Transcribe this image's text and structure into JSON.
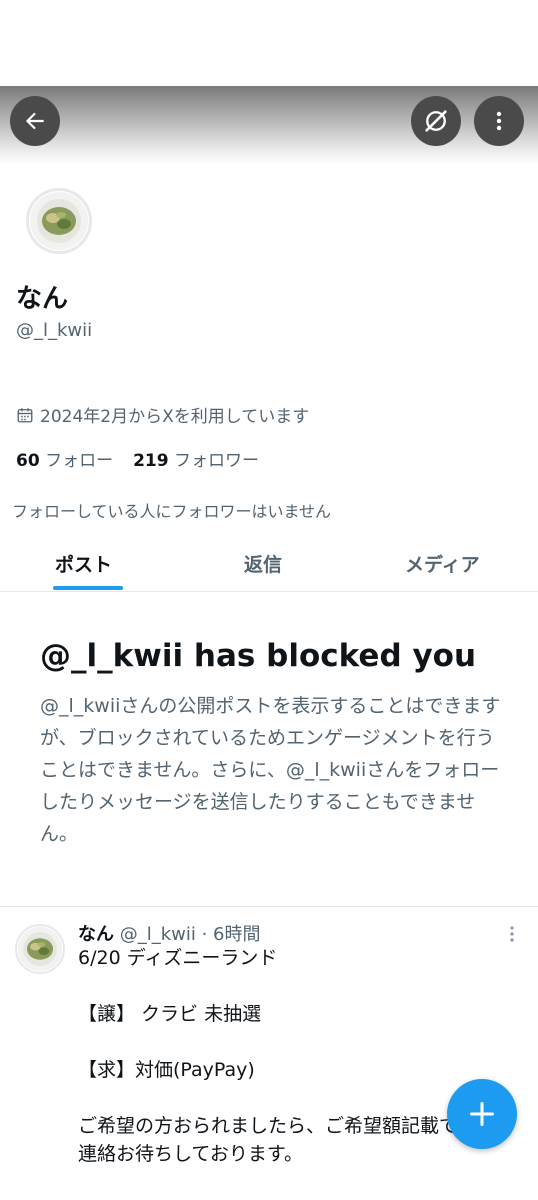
{
  "profile": {
    "display_name": "なん",
    "handle": "@_l_kwii",
    "joined": "2024年2月からXを利用しています",
    "following_count": "60",
    "following_label": "フォロー",
    "followers_count": "219",
    "followers_label": "フォロワー",
    "no_mutual_followers": "フォローしている人にフォロワーはいません"
  },
  "tabs": [
    {
      "label": "ポスト",
      "active": true
    },
    {
      "label": "返信",
      "active": false
    },
    {
      "label": "メディア",
      "active": false
    }
  ],
  "blocked": {
    "title": "@_l_kwii has blocked you",
    "description": "@_l_kwiiさんの公開ポストを表示することはできますが、ブロックされているためエンゲージメントを行うことはできません。さらに、@_l_kwiiさんをフォローしたりメッセージを送信したりすることもできません。"
  },
  "post": {
    "name": "なん",
    "meta": "@_l_kwii · 6時間",
    "text": "6/20 ディズニーランド\n\n【譲】 クラビ 未抽選\n\n【求】対価(PayPay)\n\nご希望の方おられましたら、ご希望額記載でご\n連絡お待ちしております。"
  },
  "icons": {
    "back": "arrow-left-icon",
    "grok": "grok-icon",
    "more": "more-vertical-icon",
    "calendar": "calendar-icon",
    "compose": "plus-icon"
  },
  "colors": {
    "accent": "#1d9bf0",
    "text_primary": "#0f1419",
    "text_secondary": "#536471",
    "header_button": "#4a4a4a"
  }
}
